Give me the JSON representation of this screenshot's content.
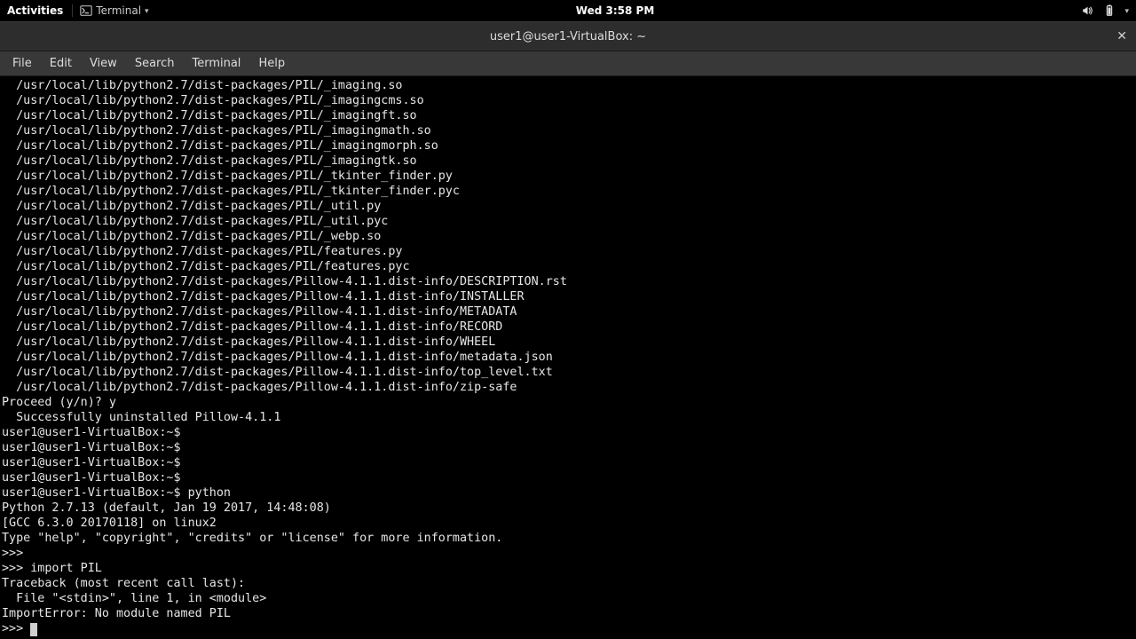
{
  "panel": {
    "activities": "Activities",
    "app_label": "Terminal",
    "clock": "Wed  3:58 PM"
  },
  "window": {
    "title": "user1@user1-VirtualBox: ~"
  },
  "menubar": {
    "file": "File",
    "edit": "Edit",
    "view": "View",
    "search": "Search",
    "terminal": "Terminal",
    "help": "Help"
  },
  "terminal": {
    "lines": [
      "  /usr/local/lib/python2.7/dist-packages/PIL/_imaging.so",
      "  /usr/local/lib/python2.7/dist-packages/PIL/_imagingcms.so",
      "  /usr/local/lib/python2.7/dist-packages/PIL/_imagingft.so",
      "  /usr/local/lib/python2.7/dist-packages/PIL/_imagingmath.so",
      "  /usr/local/lib/python2.7/dist-packages/PIL/_imagingmorph.so",
      "  /usr/local/lib/python2.7/dist-packages/PIL/_imagingtk.so",
      "  /usr/local/lib/python2.7/dist-packages/PIL/_tkinter_finder.py",
      "  /usr/local/lib/python2.7/dist-packages/PIL/_tkinter_finder.pyc",
      "  /usr/local/lib/python2.7/dist-packages/PIL/_util.py",
      "  /usr/local/lib/python2.7/dist-packages/PIL/_util.pyc",
      "  /usr/local/lib/python2.7/dist-packages/PIL/_webp.so",
      "  /usr/local/lib/python2.7/dist-packages/PIL/features.py",
      "  /usr/local/lib/python2.7/dist-packages/PIL/features.pyc",
      "  /usr/local/lib/python2.7/dist-packages/Pillow-4.1.1.dist-info/DESCRIPTION.rst",
      "  /usr/local/lib/python2.7/dist-packages/Pillow-4.1.1.dist-info/INSTALLER",
      "  /usr/local/lib/python2.7/dist-packages/Pillow-4.1.1.dist-info/METADATA",
      "  /usr/local/lib/python2.7/dist-packages/Pillow-4.1.1.dist-info/RECORD",
      "  /usr/local/lib/python2.7/dist-packages/Pillow-4.1.1.dist-info/WHEEL",
      "  /usr/local/lib/python2.7/dist-packages/Pillow-4.1.1.dist-info/metadata.json",
      "  /usr/local/lib/python2.7/dist-packages/Pillow-4.1.1.dist-info/top_level.txt",
      "  /usr/local/lib/python2.7/dist-packages/Pillow-4.1.1.dist-info/zip-safe",
      "Proceed (y/n)? y",
      "  Successfully uninstalled Pillow-4.1.1",
      "user1@user1-VirtualBox:~$ ",
      "user1@user1-VirtualBox:~$ ",
      "user1@user1-VirtualBox:~$ ",
      "user1@user1-VirtualBox:~$ ",
      "user1@user1-VirtualBox:~$ python",
      "Python 2.7.13 (default, Jan 19 2017, 14:48:08) ",
      "[GCC 6.3.0 20170118] on linux2",
      "Type \"help\", \"copyright\", \"credits\" or \"license\" for more information.",
      ">>> ",
      ">>> import PIL",
      "Traceback (most recent call last):",
      "  File \"<stdin>\", line 1, in <module>",
      "ImportError: No module named PIL"
    ],
    "prompt": ">>> "
  }
}
